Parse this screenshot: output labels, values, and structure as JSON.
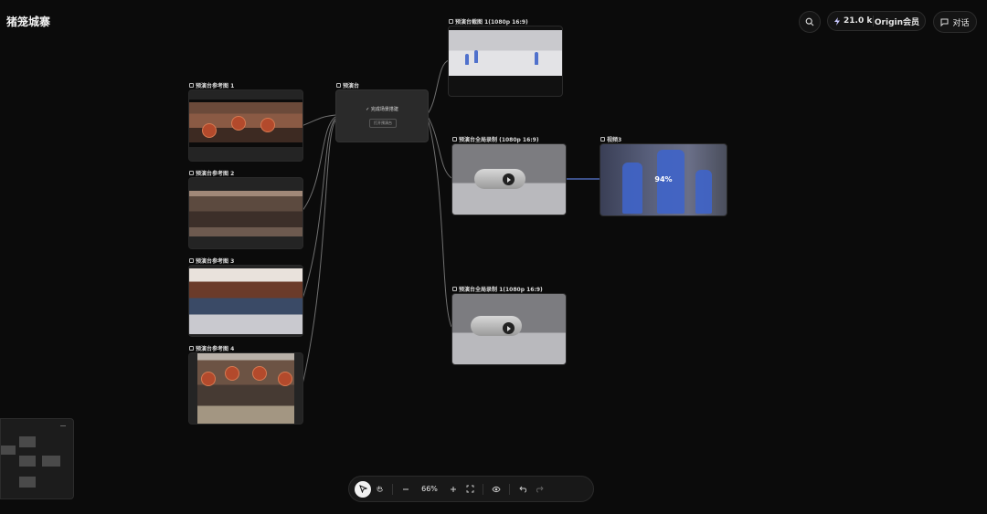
{
  "app": {
    "title": "猪笼城寨"
  },
  "header": {
    "credits": "21.0 k",
    "membership": "Origin会员",
    "chat_label": "对话"
  },
  "nodes": {
    "ref1": {
      "label": "预演台参考图 1"
    },
    "ref2": {
      "label": "预演台参考图 2"
    },
    "ref3": {
      "label": "预演台参考图 3"
    },
    "ref4": {
      "label": "预演台参考图 4"
    },
    "stage": {
      "label": "预演台",
      "status": "完成场景搭建",
      "open_button": "打开预演台"
    },
    "shot1": {
      "label": "预演台截图 1(1080p 16:9)"
    },
    "rec1": {
      "label": "预演台全局录制 (1080p 16:9)"
    },
    "rec2": {
      "label": "预演台全局录制 1(1080p 16:9)"
    },
    "video3": {
      "label": "视频3",
      "progress": "94%"
    }
  },
  "toolbar": {
    "zoom": "66%"
  },
  "colors": {
    "background": "#0b0b0b",
    "node": "#242424",
    "figure": "#3f64c9"
  },
  "icons": [
    "search-icon",
    "lightning-icon",
    "chat-icon",
    "pointer-icon",
    "hand-icon",
    "zoom-out-icon",
    "zoom-in-icon",
    "fit-screen-icon",
    "eye-icon",
    "undo-icon",
    "redo-icon"
  ]
}
